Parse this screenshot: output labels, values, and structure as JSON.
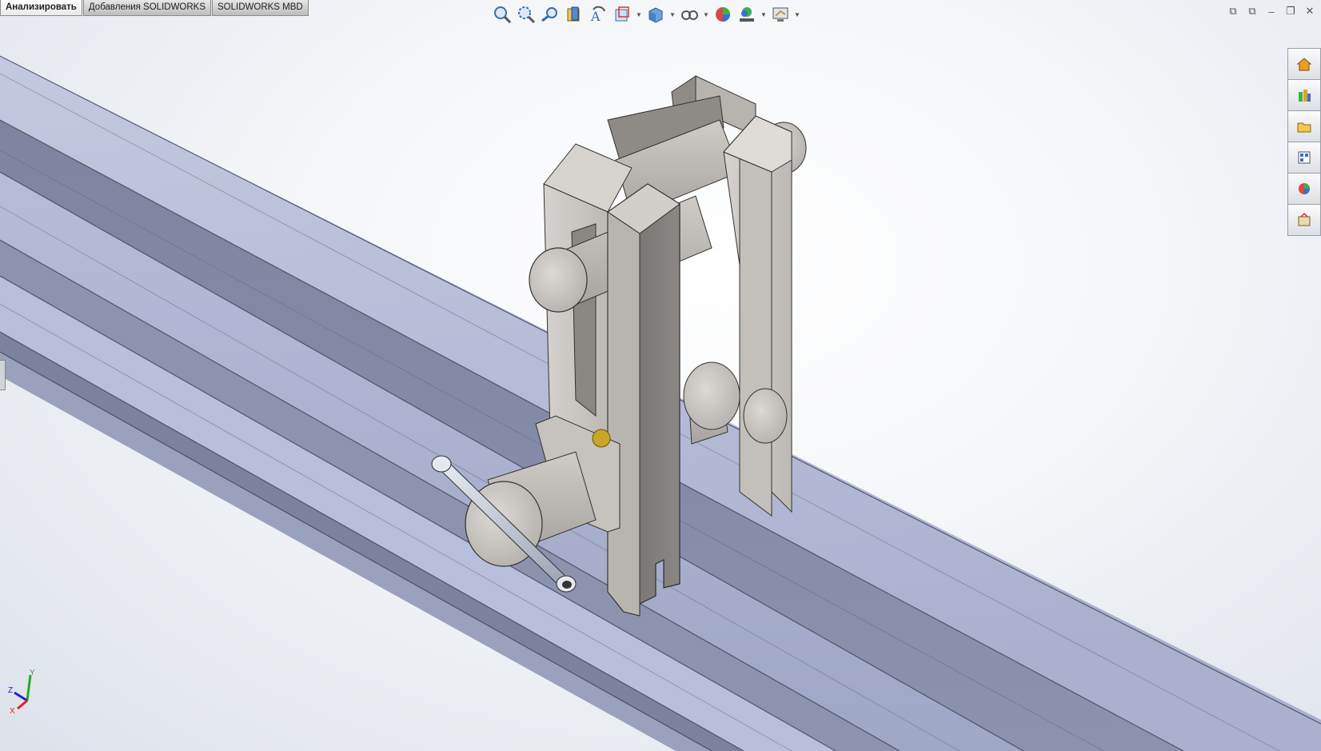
{
  "tabs": [
    {
      "label": "Анализировать",
      "active": true
    },
    {
      "label": "Добавления SOLIDWORKS",
      "active": false
    },
    {
      "label": "SOLIDWORKS MBD",
      "active": false
    }
  ],
  "heads_up_toolbar": [
    "zoom-to-fit-icon",
    "zoom-to-area-icon",
    "previous-view-icon",
    "section-view-icon",
    "dynamic-annotation-views-icon",
    "view-orientation-icon",
    "display-style-icon",
    "hide-show-items-icon",
    "edit-appearance-icon",
    "apply-scene-icon",
    "view-settings-icon"
  ],
  "task_pane": [
    "solidworks-resources-icon",
    "design-library-icon",
    "file-explorer-icon",
    "view-palette-icon",
    "appearances-scenes-icon",
    "custom-properties-icon"
  ],
  "triad": {
    "x": "X",
    "y": "Y",
    "z": "Z"
  },
  "colors": {
    "rail": "#9ea6c4",
    "part": "#9d9a97",
    "axis_x": "#d22",
    "axis_y": "#2a2",
    "axis_z": "#22c"
  }
}
